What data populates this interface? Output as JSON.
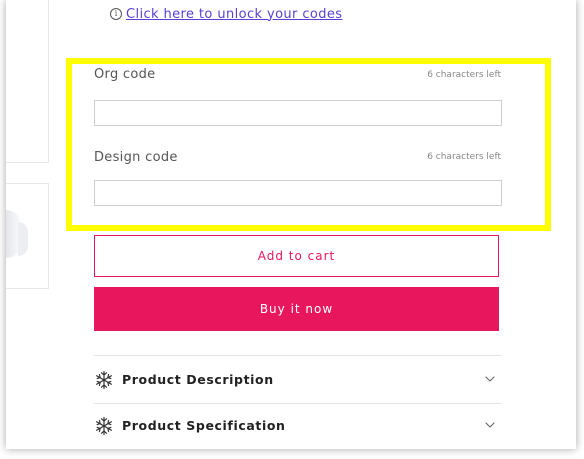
{
  "unlock": {
    "icon": "info-icon",
    "link_text": "Click here to unlock your codes"
  },
  "fields": {
    "org": {
      "label": "Org code",
      "counter": "6 characters left",
      "value": ""
    },
    "design": {
      "label": "Design code",
      "counter": "6 characters left",
      "value": ""
    }
  },
  "buttons": {
    "add_to_cart": "Add to cart",
    "buy_now": "Buy it now"
  },
  "accordions": [
    {
      "title": "Product Description",
      "icon": "snowflake-icon"
    },
    {
      "title": "Product Specification",
      "icon": "snowflake-icon"
    }
  ],
  "colors": {
    "accent": "#e8175d",
    "highlight": "#ffff00",
    "link": "#5a3fd6"
  }
}
